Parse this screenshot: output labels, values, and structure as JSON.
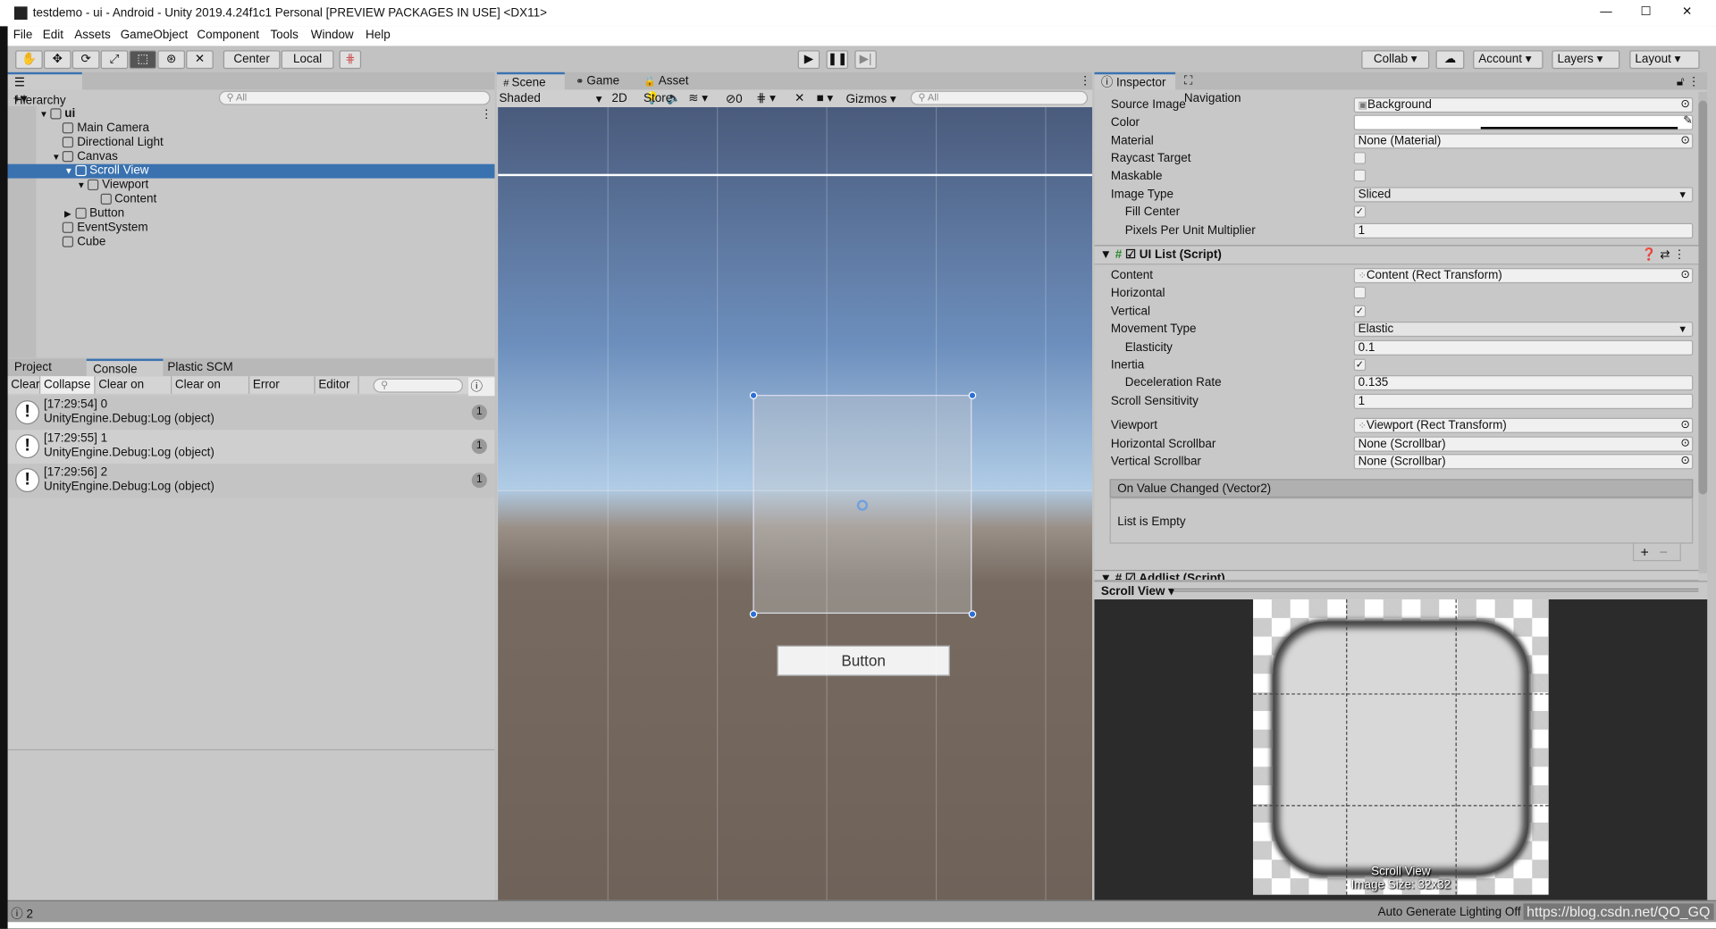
{
  "window": {
    "title": "testdemo - ui - Android - Unity 2019.4.24f1c1 Personal [PREVIEW PACKAGES IN USE] <DX11>",
    "minimize": "—",
    "maximize": "☐",
    "close": "✕"
  },
  "menu": [
    "File",
    "Edit",
    "Assets",
    "GameObject",
    "Component",
    "Tools",
    "Window",
    "Help"
  ],
  "toolbar": {
    "tools": [
      "hand-tool",
      "move-tool",
      "rotate-tool",
      "scale-tool",
      "rect-tool",
      "transform-tool",
      "custom-tool"
    ],
    "active_tool": "rect-tool",
    "pivot": "Center",
    "space": "Local",
    "collab": "Collab ▾",
    "account": "Account",
    "layers": "Layers",
    "layout": "Layout"
  },
  "hierarchy": {
    "tab": "Hierarchy",
    "add": "+▾",
    "search_placeholder": "All",
    "items": [
      {
        "label": "ui",
        "level": 0,
        "arrow": "▼",
        "bold": true
      },
      {
        "label": "Main Camera",
        "level": 1
      },
      {
        "label": "Directional Light",
        "level": 1
      },
      {
        "label": "Canvas",
        "level": 1,
        "arrow": "▼"
      },
      {
        "label": "Scroll View",
        "level": 2,
        "arrow": "▼",
        "selected": true
      },
      {
        "label": "Viewport",
        "level": 3,
        "arrow": "▼"
      },
      {
        "label": "Content",
        "level": 4
      },
      {
        "label": "Button",
        "level": 2,
        "arrow": "▶"
      },
      {
        "label": "EventSystem",
        "level": 1
      },
      {
        "label": "Cube",
        "level": 1
      }
    ]
  },
  "console": {
    "tabs": [
      "Project",
      "Console",
      "Plastic SCM"
    ],
    "active_tab": "Console",
    "buttons": [
      "Clear",
      "Collapse",
      "Clear on Play",
      "Clear on Build",
      "Error Pause",
      "Editor ▾"
    ],
    "active_button": "Collapse",
    "warn_count": "3",
    "entries": [
      {
        "line1": "[17:29:54] 0",
        "line2": "UnityEngine.Debug:Log (object)",
        "count": "1"
      },
      {
        "line1": "[17:29:55] 1",
        "line2": "UnityEngine.Debug:Log (object)",
        "count": "1"
      },
      {
        "line1": "[17:29:56] 2",
        "line2": "UnityEngine.Debug:Log (object)",
        "count": "1"
      }
    ]
  },
  "scene": {
    "tabs": [
      "Scene",
      "Game",
      "Asset Store"
    ],
    "active_tab": "Scene",
    "shading": "Shaded",
    "mode2d": "2D",
    "hidden_count": "0",
    "gizmos": "Gizmos",
    "search_placeholder": "All",
    "button_label": "Button"
  },
  "inspector": {
    "tabs": [
      "Inspector",
      "Navigation"
    ],
    "image_rows": [
      {
        "label": "Source Image",
        "type": "object",
        "value": "Background"
      },
      {
        "label": "Color",
        "type": "color",
        "value": "#ffffff"
      },
      {
        "label": "Material",
        "type": "object",
        "value": "None (Material)"
      },
      {
        "label": "Raycast Target",
        "type": "check",
        "checked": false
      },
      {
        "label": "Maskable",
        "type": "check",
        "checked": false
      },
      {
        "label": "Image Type",
        "type": "dropdown",
        "value": "Sliced"
      },
      {
        "label": "Fill Center",
        "type": "check",
        "checked": true,
        "indent": true
      },
      {
        "label": "Pixels Per Unit Multiplier",
        "type": "text",
        "value": "1",
        "indent": true
      }
    ],
    "uilist": {
      "title": "UI List (Script)",
      "rows": [
        {
          "label": "Content",
          "type": "object",
          "value": "Content (Rect Transform)"
        },
        {
          "label": "Horizontal",
          "type": "check",
          "checked": false
        },
        {
          "label": "Vertical",
          "type": "check",
          "checked": true
        },
        {
          "label": "Movement Type",
          "type": "dropdown",
          "value": "Elastic"
        },
        {
          "label": "Elasticity",
          "type": "text",
          "value": "0.1",
          "indent": true
        },
        {
          "label": "Inertia",
          "type": "check",
          "checked": true
        },
        {
          "label": "Deceleration Rate",
          "type": "text",
          "value": "0.135",
          "indent": true
        },
        {
          "label": "Scroll Sensitivity",
          "type": "text",
          "value": "1"
        },
        {
          "label": "Viewport",
          "type": "object",
          "value": "Viewport (Rect Transform)"
        },
        {
          "label": "Horizontal Scrollbar",
          "type": "object",
          "value": "None (Scrollbar)"
        },
        {
          "label": "Vertical Scrollbar",
          "type": "object",
          "value": "None (Scrollbar)"
        }
      ],
      "event": "On Value Changed (Vector2)",
      "event_empty": "List is Empty"
    },
    "addlist_title": "Addlist (Script)"
  },
  "preview": {
    "dropdown": "Scroll View ▾",
    "name": "Scroll View",
    "size": "Image Size: 32x32"
  },
  "status": {
    "warn_count": "2",
    "lighting": "Auto Generate Lighting Off",
    "watermark": "https://blog.csdn.net/QO_GQ"
  },
  "colors": {
    "selection": "#3a72b0",
    "panel": "#c8c8c8",
    "sky_top": "#4a5b7c",
    "horizon": "#b0cce6",
    "ground": "#6e6259"
  }
}
